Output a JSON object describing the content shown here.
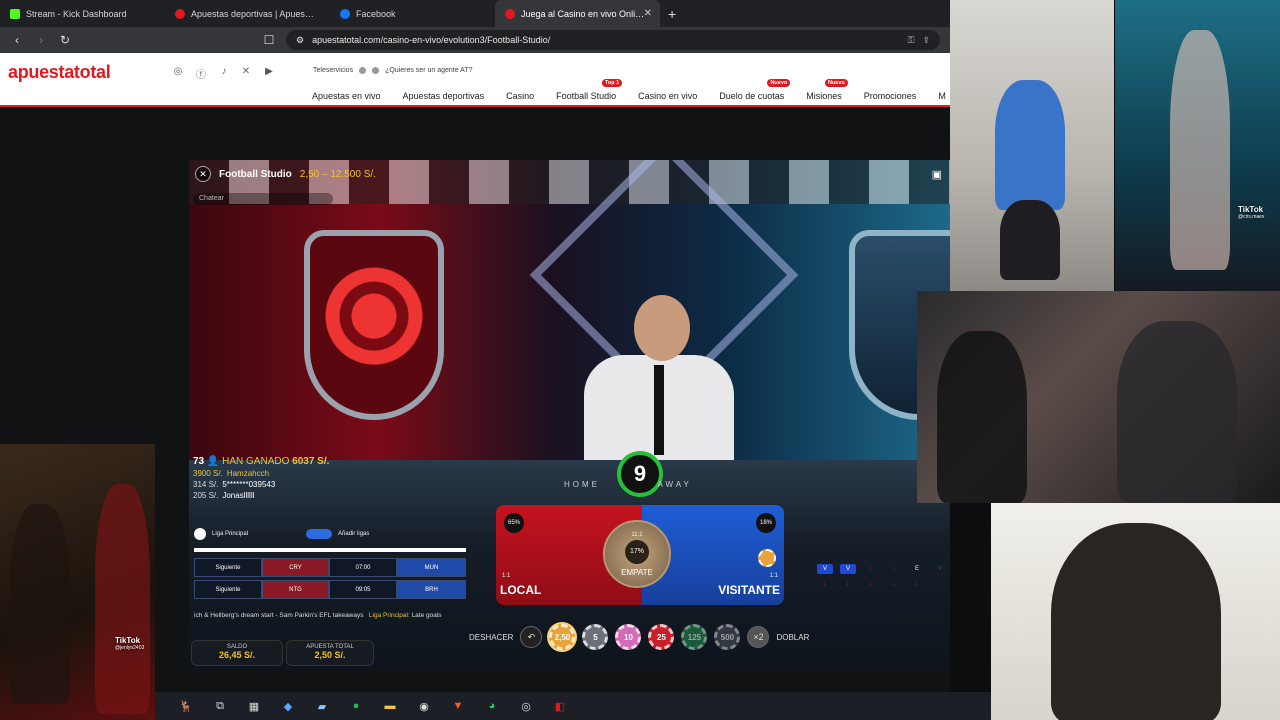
{
  "browser": {
    "tabs": [
      {
        "title": "Stream - Kick Dashboard",
        "icon": "kick-icon",
        "color": "#53fc18"
      },
      {
        "title": "Apuestas deportivas | Apuestas onlin",
        "icon": "apuestatotal-favicon",
        "color": "#e0191e"
      },
      {
        "title": "Facebook",
        "icon": "facebook-icon",
        "color": "#1877f2"
      },
      {
        "title": "Juega al Casino en vivo Online |",
        "icon": "apuestatotal-favicon",
        "color": "#e0191e",
        "active": true
      }
    ],
    "url": "apuestatotal.com/casino-en-vivo/evolution3/Football-Studio/"
  },
  "site": {
    "logo": "apuestatotal",
    "teleservicios": "Teleservicios",
    "agent_link": "¿Quieres ser un agente AT?",
    "menu": [
      {
        "label": "Apuestas en vivo"
      },
      {
        "label": "Apuestas deportivas"
      },
      {
        "label": "Casino"
      },
      {
        "label": "Football Studio",
        "badge": "Top 1"
      },
      {
        "label": "Casino en vivo"
      },
      {
        "label": "Duelo de cuotas",
        "badge": "Nuevo"
      },
      {
        "label": "Misiones",
        "badge": "Nuevo"
      },
      {
        "label": "Promociones"
      },
      {
        "label": "M"
      }
    ]
  },
  "game": {
    "title": "Football Studio",
    "limits": "2,50 – 12.500 S/.",
    "chat_placeholder": "Chatear",
    "winners_count": "73",
    "winners_label": "HAN GANADO",
    "winners_amount": "6037 S/.",
    "winners": [
      {
        "amount": "3900 S/.",
        "name": "Hamzahcch"
      },
      {
        "amount": "314 S/.",
        "name": "5*******039543"
      },
      {
        "amount": "205 S/.",
        "name": "Jonasllllll"
      }
    ],
    "timer": "9",
    "home_label": "HOME",
    "away_label": "AWAY",
    "league_label": "Liga Principal",
    "add_league": "Añadir ligas",
    "fixtures": [
      {
        "label": "Siguiente",
        "home": "CRY",
        "time": "07:00",
        "away": "MUN"
      },
      {
        "label": "Siguiente",
        "home": "NTG",
        "time": "09:05",
        "away": "BRH"
      }
    ],
    "ticker_text": "ich & Hellberg's dream start - Sam Parkin's EFL takeaways",
    "ticker_label": "Liga Principal:",
    "ticker_tail": "Late goals",
    "local": {
      "label": "LOCAL",
      "pct": "65%",
      "ratio": "1:1"
    },
    "visitante": {
      "label": "VISITANTE",
      "pct": "18%",
      "ratio": "1:1"
    },
    "empate": {
      "label": "EMPATE",
      "pct": "17%",
      "ratio": "11:1"
    },
    "history": [
      [
        "V",
        "V",
        "L",
        "L",
        "E",
        "V",
        "V"
      ],
      [
        "L",
        "L",
        "L",
        "L",
        "L",
        "",
        ""
      ]
    ],
    "controls": {
      "undo": "DESHACER",
      "double": "DOBLAR",
      "double_icon": "×2",
      "chips": [
        {
          "value": "2,50",
          "color": "#e8a33a"
        },
        {
          "value": "5",
          "color": "#6a6f78"
        },
        {
          "value": "10",
          "color": "#d46bb7"
        },
        {
          "value": "25",
          "color": "#c8202a"
        },
        {
          "value": "125",
          "color": "#1e8a4a"
        },
        {
          "value": "500",
          "color": "#4a4f58"
        }
      ]
    },
    "saldo": {
      "label": "SALDO",
      "value": "26,45 S/."
    },
    "apuesta_total": {
      "label": "APUESTA TOTAL",
      "value": "2,50 S/."
    }
  },
  "overlays": {
    "tiktok_label": "TikTok",
    "cam2_handle": "@cris.maex",
    "cam5_handle": "@jenlyn2403"
  },
  "taskbar": [
    {
      "icon": "deer-wallpaper-icon"
    },
    {
      "icon": "task-view-icon"
    },
    {
      "icon": "calculator-icon"
    },
    {
      "icon": "copilot-icon"
    },
    {
      "icon": "sticky-notes-icon"
    },
    {
      "icon": "spotify-icon"
    },
    {
      "icon": "file-explorer-icon"
    },
    {
      "icon": "obs-icon"
    },
    {
      "icon": "brave-icon"
    },
    {
      "icon": "whatsapp-icon"
    },
    {
      "icon": "chrome-icon"
    },
    {
      "icon": "app-icon"
    }
  ]
}
